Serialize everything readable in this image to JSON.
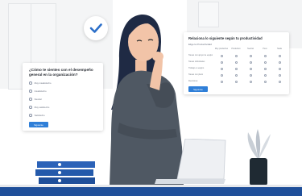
{
  "left_card": {
    "title": "¿Cómo te sientes con el desempeño general en la organización?",
    "options": [
      "Muy insatisfecho",
      "Insatisfecho",
      "Neutral",
      "Muy satisfecho",
      "Satisfecho"
    ],
    "button": "Siguiente"
  },
  "right_card": {
    "title": "Relaciona lo siguiente según tu productividad",
    "subtitle": "Elige la Productividad",
    "columns": [
      "Muy productivo",
      "Productivo",
      "Neutral",
      "Poco",
      "Nada"
    ],
    "rows": [
      "Tareas con apoyo de equipo",
      "Tareas individuales",
      "Trabajo en equipo",
      "Tareas con plazo",
      "Reuniones"
    ],
    "button": "Siguiente"
  },
  "colors": {
    "accent_blue": "#2f7fd8",
    "checkmark_blue": "#2c6fc9",
    "hair": "#1f2a44",
    "skin": "#f2c4a8",
    "shirt": "#4f5863",
    "floor_blue": "#1f4f9a"
  },
  "icons": [
    "check-icon"
  ]
}
